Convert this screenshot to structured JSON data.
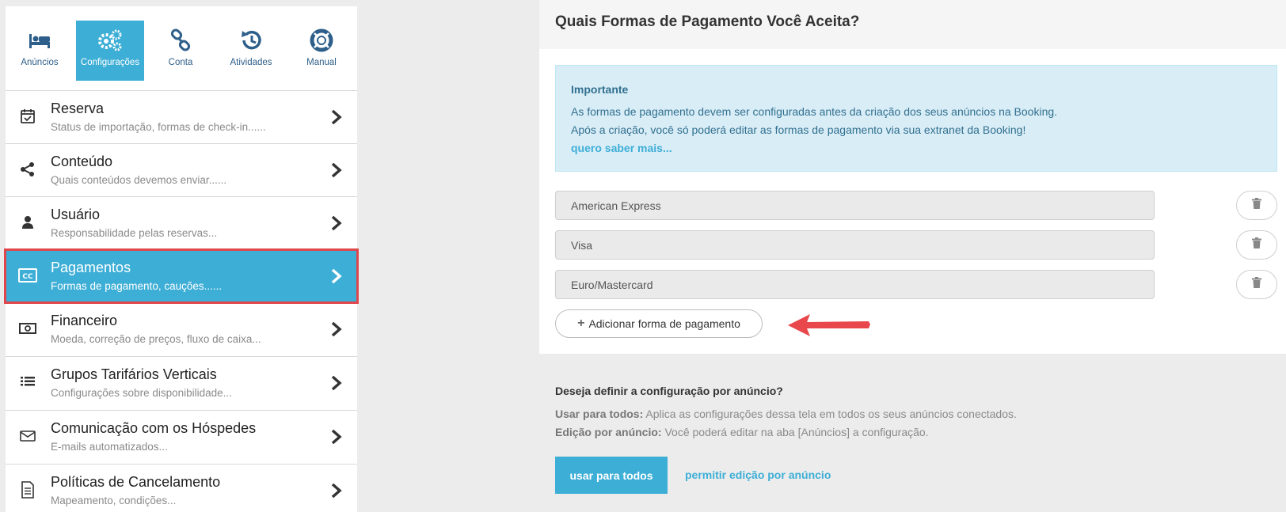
{
  "nav": [
    {
      "label": "Anúncios",
      "icon": "bed-icon",
      "active": false
    },
    {
      "label": "Configurações",
      "icon": "gears-icon",
      "active": true
    },
    {
      "label": "Conta",
      "icon": "link-icon",
      "active": false
    },
    {
      "label": "Atividades",
      "icon": "history-icon",
      "active": false
    },
    {
      "label": "Manual",
      "icon": "lifebuoy-icon",
      "active": false
    }
  ],
  "menu": [
    {
      "title": "Reserva",
      "subtitle": "Status de importação, formas de check-in......",
      "icon": "calendar-check-icon"
    },
    {
      "title": "Conteúdo",
      "subtitle": "Quais conteúdos devemos enviar......",
      "icon": "share-icon"
    },
    {
      "title": "Usuário",
      "subtitle": "Responsabilidade pelas reservas...",
      "icon": "user-icon"
    },
    {
      "title": "Pagamentos",
      "subtitle": "Formas de pagamento, cauções......",
      "icon": "credit-card-icon",
      "active": true
    },
    {
      "title": "Financeiro",
      "subtitle": "Moeda, correção de preços, fluxo de caixa...",
      "icon": "money-icon"
    },
    {
      "title": "Grupos Tarifários Verticais",
      "subtitle": "Configurações sobre disponibilidade...",
      "icon": "list-icon"
    },
    {
      "title": "Comunicação com os Hóspedes",
      "subtitle": "E-mails automatizados...",
      "icon": "envelope-icon"
    },
    {
      "title": "Políticas de Cancelamento",
      "subtitle": "Mapeamento, condições...",
      "icon": "document-icon"
    }
  ],
  "main": {
    "title": "Quais Formas de Pagamento Você Aceita?",
    "alert": {
      "title": "Importante",
      "line1": "As formas de pagamento devem ser configuradas antes da criação dos seus anúncios na Booking.",
      "line2": "Após a criação, você só poderá editar as formas de pagamento via sua extranet da Booking!",
      "link": "quero saber mais..."
    },
    "payments": [
      "American Express",
      "Visa",
      "Euro/Mastercard"
    ],
    "add_button": "Adicionar forma de pagamento",
    "config": {
      "question": "Deseja definir a configuração por anúncio?",
      "all_label": "Usar para todos:",
      "all_text": " Aplica as configurações dessa tela em todos os seus anúncios conectados.",
      "per_label": "Edição por anúncio:",
      "per_text": " Você poderá editar na aba [Anúncios] a configuração.",
      "btn_all": "usar para todos",
      "link_per": "permitir edição por anúncio"
    }
  },
  "colors": {
    "accent": "#3daed6",
    "highlight_border": "#e0474c",
    "alert_bg": "#d9edf7",
    "alert_text": "#31708f",
    "arrow": "#e8474c"
  }
}
